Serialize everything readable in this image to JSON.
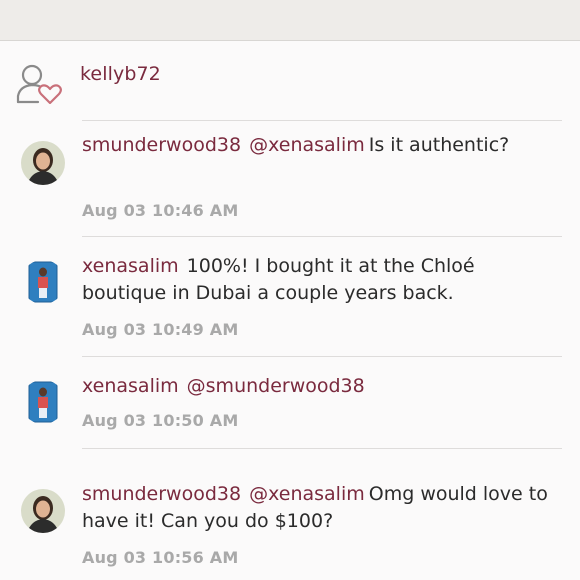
{
  "likes": {
    "icon": "person-heart-icon",
    "user": "kellyb72"
  },
  "comments": [
    {
      "username": "smunderwood38",
      "mention": "@xenasalim",
      "text": "Is it authentic?",
      "timestamp": "Aug 03 10:46 AM",
      "avatar": "avatar-smunderwood38"
    },
    {
      "username": "xenasalim",
      "mention": "",
      "text": "100%! I bought it at the Chloé boutique in Dubai a couple years back.",
      "timestamp": "Aug 03 10:49 AM",
      "avatar": "avatar-xenasalim"
    },
    {
      "username": "xenasalim",
      "mention": "@smunderwood38",
      "text": "",
      "timestamp": "Aug 03 10:50 AM",
      "avatar": "avatar-xenasalim"
    },
    {
      "username": "smunderwood38",
      "mention": "@xenasalim",
      "text": "Omg would love to have it!  Can you do $100?",
      "timestamp": "Aug 03 10:56 AM",
      "avatar": "avatar-smunderwood38"
    }
  ],
  "colors": {
    "accent": "#7a2a3e",
    "timestamp": "#a9a9a9",
    "heart": "#c9707a"
  }
}
